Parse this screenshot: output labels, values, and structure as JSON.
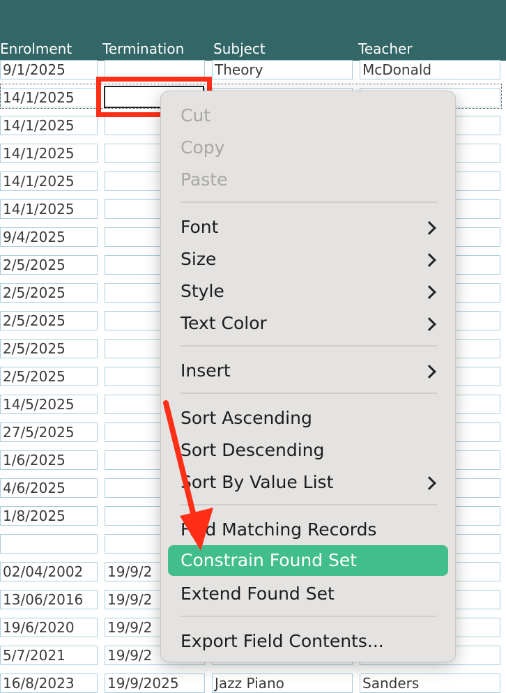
{
  "columns": {
    "enrolment": "Enrolment",
    "termination": "Termination",
    "subject": "Subject",
    "teacher": "Teacher"
  },
  "rows": [
    {
      "enrolment": "9/1/2025",
      "termination": "",
      "subject": "Theory",
      "teacher": "McDonald"
    },
    {
      "enrolment": "14/1/2025",
      "termination": "",
      "subject": "",
      "teacher": ""
    },
    {
      "enrolment": "14/1/2025",
      "termination": "",
      "subject": "",
      "teacher": ""
    },
    {
      "enrolment": "14/1/2025",
      "termination": "",
      "subject": "",
      "teacher": ""
    },
    {
      "enrolment": "14/1/2025",
      "termination": "",
      "subject": "",
      "teacher": ""
    },
    {
      "enrolment": "14/1/2025",
      "termination": "",
      "subject": "",
      "teacher": ""
    },
    {
      "enrolment": "9/4/2025",
      "termination": "",
      "subject": "",
      "teacher": ""
    },
    {
      "enrolment": "2/5/2025",
      "termination": "",
      "subject": "",
      "teacher": ""
    },
    {
      "enrolment": "2/5/2025",
      "termination": "",
      "subject": "",
      "teacher": ""
    },
    {
      "enrolment": "2/5/2025",
      "termination": "",
      "subject": "",
      "teacher": ""
    },
    {
      "enrolment": "2/5/2025",
      "termination": "",
      "subject": "",
      "teacher": ""
    },
    {
      "enrolment": "2/5/2025",
      "termination": "",
      "subject": "",
      "teacher": ""
    },
    {
      "enrolment": "14/5/2025",
      "termination": "",
      "subject": "",
      "teacher": ""
    },
    {
      "enrolment": "27/5/2025",
      "termination": "",
      "subject": "",
      "teacher": ""
    },
    {
      "enrolment": "1/6/2025",
      "termination": "",
      "subject": "",
      "teacher": ""
    },
    {
      "enrolment": "4/6/2025",
      "termination": "",
      "subject": "",
      "teacher": ""
    },
    {
      "enrolment": "1/8/2025",
      "termination": "",
      "subject": "",
      "teacher": ""
    },
    {
      "enrolment": "",
      "termination": "",
      "subject": "",
      "teacher": ""
    },
    {
      "enrolment": "02/04/2002",
      "termination": "19/9/2",
      "subject": "",
      "teacher": ""
    },
    {
      "enrolment": "13/06/2016",
      "termination": "19/9/2",
      "subject": "",
      "teacher": ""
    },
    {
      "enrolment": "19/6/2020",
      "termination": "19/9/2",
      "subject": "",
      "teacher": ""
    },
    {
      "enrolment": "5/7/2021",
      "termination": "19/9/2",
      "subject": "",
      "teacher": ""
    },
    {
      "enrolment": "16/8/2023",
      "termination": "19/9/2025",
      "subject": "Jazz Piano",
      "teacher": "Sanders"
    }
  ],
  "menu": {
    "cut": "Cut",
    "copy": "Copy",
    "paste": "Paste",
    "font": "Font",
    "size": "Size",
    "style": "Style",
    "text_color": "Text Color",
    "insert": "Insert",
    "sort_ascending": "Sort Ascending",
    "sort_descending": "Sort Descending",
    "sort_by_value_list": "Sort By Value List",
    "find_matching": "Find Matching Records",
    "constrain": "Constrain Found Set",
    "extend": "Extend Found Set",
    "export": "Export Field Contents..."
  },
  "colors": {
    "header": "#336666",
    "highlight": "#ff2e17",
    "menu_selected": "#42bd8c",
    "cell_border": "#a9cfdd"
  }
}
